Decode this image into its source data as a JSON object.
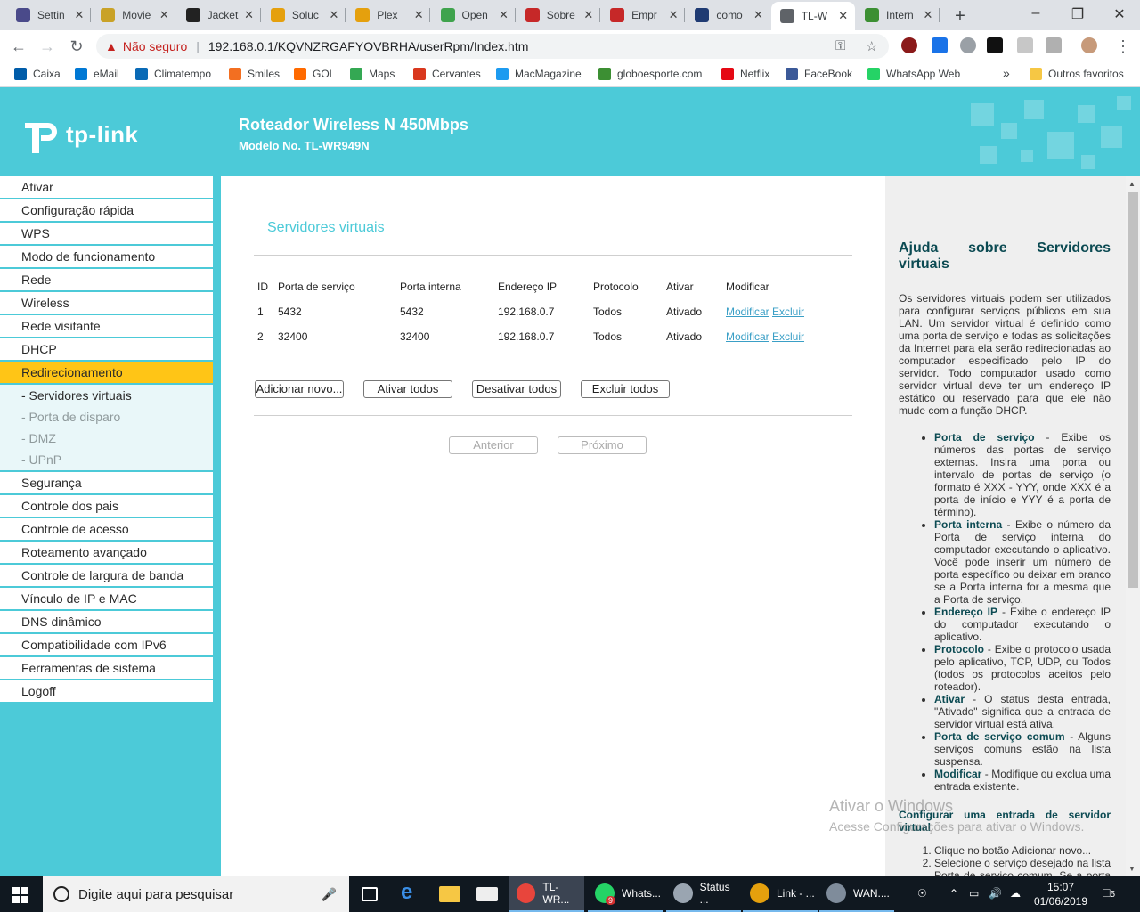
{
  "browser": {
    "tabs": [
      {
        "label": "Settin",
        "icon": "x-icon",
        "color": "#4a4a8a"
      },
      {
        "label": "Movie",
        "icon": "mask-icon",
        "color": "#c9a227"
      },
      {
        "label": "Jacket",
        "icon": "jacket-icon",
        "color": "#222222"
      },
      {
        "label": "Soluc",
        "icon": "plex-icon",
        "color": "#e5a00d"
      },
      {
        "label": "Plex",
        "icon": "plex-icon",
        "color": "#e5a00d"
      },
      {
        "label": "Open",
        "icon": "globe-icon",
        "color": "#3fa34d"
      },
      {
        "label": "Sobre",
        "icon": "router-icon",
        "color": "#c62828"
      },
      {
        "label": "Empr",
        "icon": "router-icon",
        "color": "#c62828"
      },
      {
        "label": "como",
        "icon": "dh-icon",
        "color": "#1f3b73"
      },
      {
        "label": "TL-W",
        "icon": "globe-icon",
        "color": "#5f6368"
      },
      {
        "label": "Intern",
        "icon": "ge-icon",
        "color": "#3c8f33"
      }
    ],
    "address": {
      "security": "Não seguro",
      "url": "192.168.0.1/KQVNZRGAFYOVBRHA/userRpm/Index.htm"
    },
    "bookmarks": [
      {
        "label": "Caixa",
        "color": "#005ca9"
      },
      {
        "label": "eMail",
        "color": "#0078d4"
      },
      {
        "label": "Climatempo",
        "color": "#0a6ab6"
      },
      {
        "label": "Smiles",
        "color": "#f36f21"
      },
      {
        "label": "GOL",
        "color": "#ff6a00"
      },
      {
        "label": "Maps",
        "color": "#34a853"
      },
      {
        "label": "Cervantes",
        "color": "#d9381e"
      },
      {
        "label": "MacMagazine",
        "color": "#1d9bf0"
      },
      {
        "label": "globoesporte.com",
        "color": "#3c8f33"
      },
      {
        "label": "Netflix",
        "color": "#e50914"
      },
      {
        "label": "FaceBook",
        "color": "#3b5998"
      },
      {
        "label": "WhatsApp Web",
        "color": "#25d366"
      }
    ],
    "bookmarks_more": "»",
    "other_bookmarks": "Outros favoritos"
  },
  "router": {
    "brand": "tp-link",
    "product_title": "Roteador Wireless N 450Mbps",
    "model": "Modelo No. TL-WR949N",
    "menu": [
      {
        "label": "Ativar",
        "type": "main"
      },
      {
        "label": "Configuração rápida",
        "type": "main"
      },
      {
        "label": "WPS",
        "type": "main"
      },
      {
        "label": "Modo de funcionamento",
        "type": "main"
      },
      {
        "label": "Rede",
        "type": "main"
      },
      {
        "label": "Wireless",
        "type": "main"
      },
      {
        "label": "Rede visitante",
        "type": "main"
      },
      {
        "label": "DHCP",
        "type": "main"
      },
      {
        "label": "Redirecionamento",
        "type": "active"
      },
      {
        "label": "- Servidores virtuais",
        "type": "sub-current"
      },
      {
        "label": "- Porta de disparo",
        "type": "sub"
      },
      {
        "label": "- DMZ",
        "type": "sub"
      },
      {
        "label": "- UPnP",
        "type": "sub-last"
      },
      {
        "label": "Segurança",
        "type": "main"
      },
      {
        "label": "Controle dos pais",
        "type": "main"
      },
      {
        "label": "Controle de acesso",
        "type": "main"
      },
      {
        "label": "Roteamento avançado",
        "type": "main"
      },
      {
        "label": "Controle de largura de banda",
        "type": "main"
      },
      {
        "label": "Vínculo de IP e MAC",
        "type": "main"
      },
      {
        "label": "DNS dinâmico",
        "type": "main"
      },
      {
        "label": "Compatibilidade com IPv6",
        "type": "main"
      },
      {
        "label": "Ferramentas de sistema",
        "type": "main"
      },
      {
        "label": "Logoff",
        "type": "main"
      }
    ],
    "page_title": "Servidores virtuais",
    "table": {
      "headers": [
        "ID",
        "Porta de serviço",
        "Porta interna",
        "Endereço IP",
        "Protocolo",
        "Ativar",
        "Modificar"
      ],
      "rows": [
        {
          "id": "1",
          "service_port": "5432",
          "internal_port": "5432",
          "ip": "192.168.0.7",
          "protocol": "Todos",
          "status": "Ativado",
          "modify": "Modificar",
          "delete": "Excluir"
        },
        {
          "id": "2",
          "service_port": "32400",
          "internal_port": "32400",
          "ip": "192.168.0.7",
          "protocol": "Todos",
          "status": "Ativado",
          "modify": "Modificar",
          "delete": "Excluir"
        }
      ]
    },
    "buttons": {
      "add": "Adicionar novo...",
      "enable_all": "Ativar todos",
      "disable_all": "Desativar todos",
      "delete_all": "Excluir todos",
      "prev": "Anterior",
      "next": "Próximo"
    },
    "help": {
      "title_line1": "Ajuda sobre Servidores",
      "title_line2": "virtuais",
      "intro": "Os servidores virtuais podem ser utilizados para configurar serviços públicos em sua LAN. Um servidor virtual é definido como uma porta de serviço e todas as solicitações da Internet para ela serão redirecionadas ao computador especificado pelo IP do servidor. Todo computador usado como servidor virtual deve ter um endereço IP estático ou reservado para que ele não mude com a função DHCP.",
      "items": [
        {
          "term": "Porta de serviço",
          "text": " - Exibe os números das portas de serviço externas. Insira uma porta ou intervalo de portas de serviço (o formato é XXX - YYY, onde XXX é a porta de início e YYY é a porta de término)."
        },
        {
          "term": "Porta interna",
          "text": " - Exibe o número da Porta de serviço interna do computador executando o aplicativo. Você pode inserir um número de porta específico ou deixar em branco se a Porta interna for a mesma que a Porta de serviço."
        },
        {
          "term": "Endereço IP",
          "text": " - Exibe o endereço IP do computador executando o aplicativo."
        },
        {
          "term": "Protocolo",
          "text": " - Exibe o protocolo usada pelo aplicativo, TCP, UDP, ou Todos (todos os protocolos aceitos pelo roteador)."
        },
        {
          "term": "Ativar",
          "text": " - O status desta entrada, \"Ativado\" significa que a entrada de servidor virtual está ativa."
        },
        {
          "term": "Porta de serviço comum",
          "text": " - Alguns serviços comuns estão na lista suspensa."
        },
        {
          "term": "Modificar",
          "text": " - Modifique ou exclua uma entrada existente."
        }
      ],
      "config_title": "Configurar uma entrada de servidor virtual",
      "steps": [
        "Clique no botão Adicionar novo...",
        "Selecione o serviço desejado na lista Porta de serviço comum. Se a porta desejada não se encontra na"
      ]
    }
  },
  "watermark": {
    "line1": "Ativar o Windows",
    "line2": "Acesse Configurações para ativar o Windows."
  },
  "taskbar": {
    "search_placeholder": "Digite aqui para pesquisar",
    "apps": [
      {
        "label": "TL-WR...",
        "color": "#e8453c",
        "active": true
      },
      {
        "label": "Whats...",
        "color": "#25d366",
        "active": false,
        "badge": "9"
      },
      {
        "label": "Status ...",
        "color": "#9aa5b1",
        "active": false
      },
      {
        "label": "Link - ...",
        "color": "#e5a00d",
        "active": false
      },
      {
        "label": "WAN....",
        "color": "#7f8c9b",
        "active": false
      }
    ],
    "time": "15:07",
    "date": "01/06/2019",
    "notifications": "5"
  }
}
